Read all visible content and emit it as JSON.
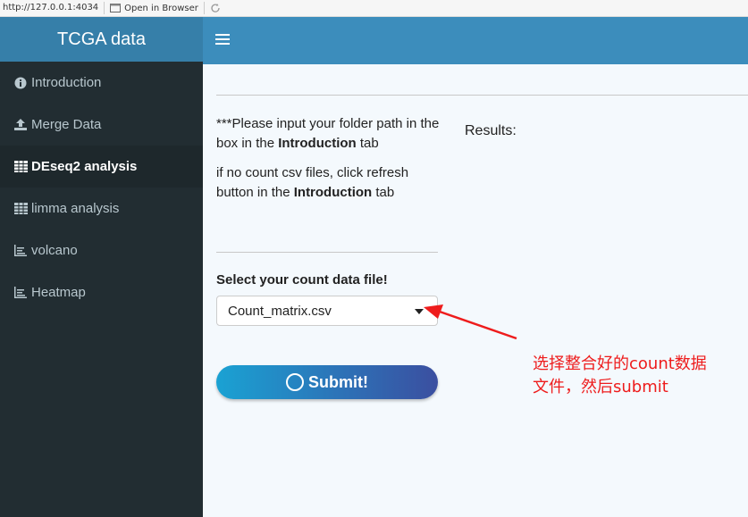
{
  "browser": {
    "url": "http://127.0.0.1:4034",
    "open_label": "Open in Browser"
  },
  "header": {
    "title": "TCGA data"
  },
  "sidebar": {
    "items": [
      {
        "label": "Introduction",
        "icon": "info-circle-icon"
      },
      {
        "label": "Merge Data",
        "icon": "upload-icon"
      },
      {
        "label": "DEseq2 analysis",
        "icon": "table-icon"
      },
      {
        "label": "limma analysis",
        "icon": "table-icon"
      },
      {
        "label": "volcano",
        "icon": "line-chart-icon"
      },
      {
        "label": "Heatmap",
        "icon": "line-chart-icon"
      }
    ],
    "active_index": 2
  },
  "main": {
    "note1_prefix": "***Please input your folder path in the box in the ",
    "note1_bold": "Introduction",
    "note1_suffix": " tab",
    "note2_prefix": "if no count csv files, click refresh button in the ",
    "note2_bold": "Introduction",
    "note2_suffix": " tab",
    "results_label": "Results:",
    "select_label": "Select your count data file!",
    "select_value": "Count_matrix.csv",
    "submit_label": "Submit!"
  },
  "annotation": {
    "text_line1": "选择整合好的count数据",
    "text_line2": "文件，然后submit",
    "color": "#ee1c1c"
  },
  "colors": {
    "sidebar_bg": "#222d32",
    "header_bg": "#3c8dbc",
    "logo_bg": "#367fa9"
  }
}
